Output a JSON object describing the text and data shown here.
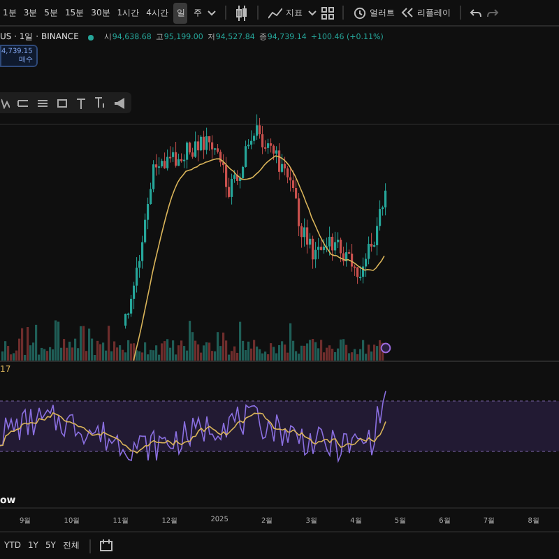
{
  "toolbar": {
    "intervals": [
      {
        "label": "1분",
        "selected": false
      },
      {
        "label": "3분",
        "selected": false
      },
      {
        "label": "5분",
        "selected": false
      },
      {
        "label": "15분",
        "selected": false
      },
      {
        "label": "30분",
        "selected": false
      },
      {
        "label": "1시간",
        "selected": false
      },
      {
        "label": "4시간",
        "selected": false
      },
      {
        "label": "일",
        "selected": true
      },
      {
        "label": "주",
        "selected": false
      }
    ],
    "indicators": "지표",
    "alert": "얼러트",
    "replay": "리플레이"
  },
  "legend": {
    "symbol": "US · 1일 · BINANCE",
    "ohlc": [
      {
        "label": "시",
        "value": "94,638.68"
      },
      {
        "label": "고",
        "value": "95,199.00"
      },
      {
        "label": "저",
        "value": "94,527.84"
      },
      {
        "label": "종",
        "value": "94,739.14"
      }
    ],
    "change": "+100.46 (+0.11%)"
  },
  "price_badge": {
    "price": "4,739.15",
    "caption": "매수"
  },
  "rsi": {
    "label": "17"
  },
  "pane_label": "ow",
  "time_axis": [
    "9월",
    "10월",
    "11월",
    "12월",
    "2025",
    "2월",
    "3월",
    "4월",
    "5월",
    "6월",
    "7월",
    "8월"
  ],
  "range_buttons": [
    "YTD",
    "1Y",
    "5Y",
    "전체"
  ]
}
